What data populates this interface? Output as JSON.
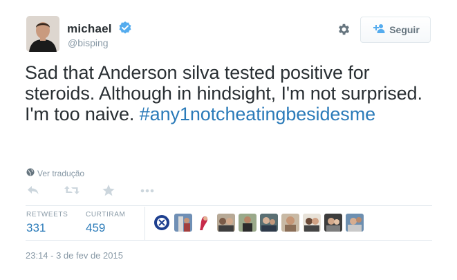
{
  "header": {
    "name": "michael",
    "handle": "@bisping",
    "follow_label": "Seguir",
    "verified_color": "#55acee"
  },
  "tweet": {
    "text": "Sad that Anderson silva tested positive for steroids. Although in hindsight, I'm not surprised. I'm too naive.",
    "hashtag": "#any1notcheatingbesidesme",
    "translate_label": "Ver tradução"
  },
  "actions": {
    "icons": [
      "reply-icon",
      "retweet-icon",
      "favorite-icon",
      "more-icon"
    ]
  },
  "stats": {
    "retweets_label": "RETWEETS",
    "retweets_value": "331",
    "likes_label": "CURTIRAM",
    "likes_value": "459"
  },
  "likers": {
    "count": 10
  },
  "timestamp": "23:14 - 3 de fev de 2015",
  "colors": {
    "link": "#2b7bb9",
    "muted": "#8899a6",
    "text": "#292f33"
  }
}
